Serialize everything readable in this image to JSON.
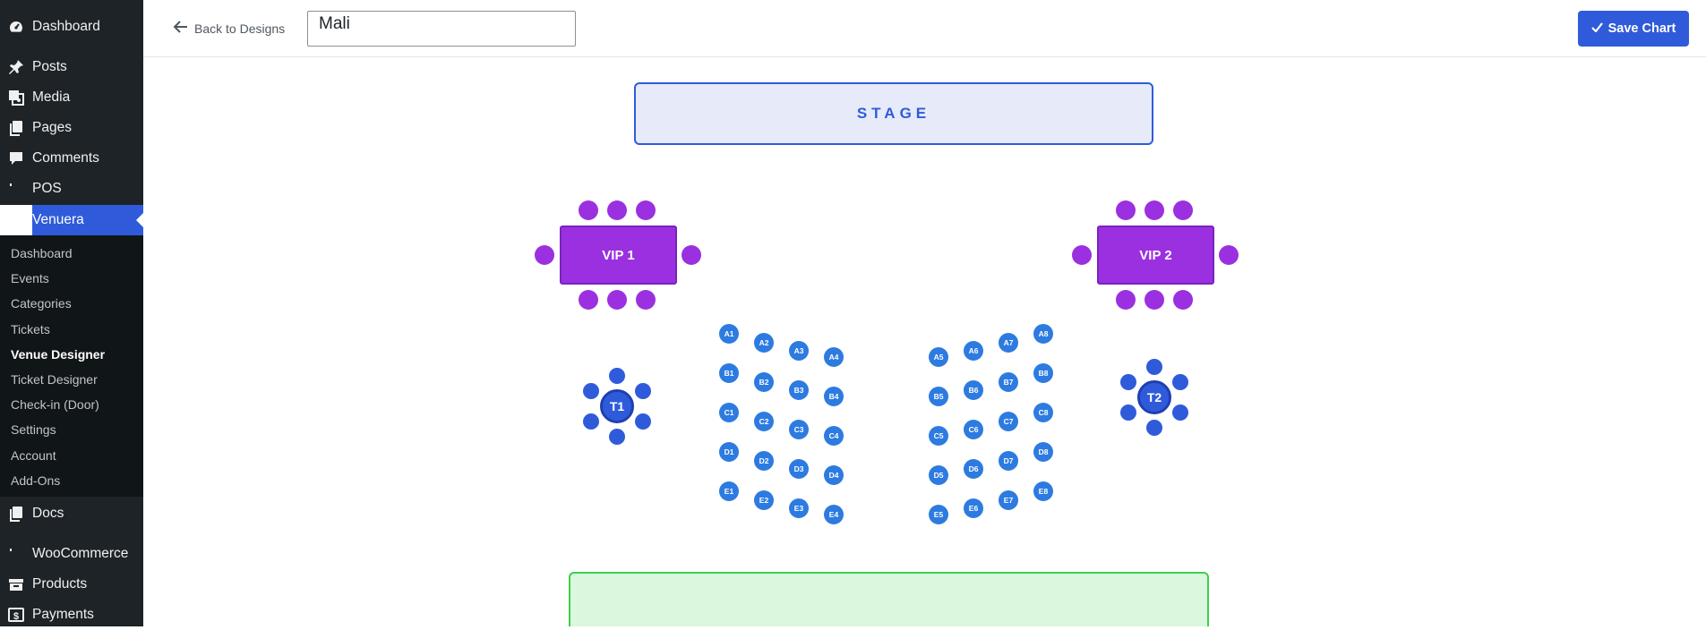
{
  "menu": {
    "dashboard": "Dashboard",
    "posts": "Posts",
    "media": "Media",
    "pages": "Pages",
    "comments": "Comments",
    "pos": "POS",
    "venuera": "Venuera",
    "docs": "Docs",
    "woocommerce": "WooCommerce",
    "products": "Products",
    "payments": "Payments"
  },
  "submenu": [
    "Dashboard",
    "Events",
    "Categories",
    "Tickets",
    "Venue Designer",
    "Ticket Designer",
    "Check-in (Door)",
    "Settings",
    "Account",
    "Add-Ons"
  ],
  "submenu_active": "Venue Designer",
  "toolbar": {
    "back_label": "Back to Designs",
    "design_name": "Mali",
    "save_label": "Save Chart"
  },
  "chart": {
    "stage_label": "STAGE",
    "vip_tables": [
      "VIP 1",
      "VIP 2"
    ],
    "round_tables": [
      "T1",
      "T2"
    ],
    "left_block": [
      [
        "A1",
        "A2",
        "A3",
        "A4"
      ],
      [
        "B1",
        "B2",
        "B3",
        "B4"
      ],
      [
        "C1",
        "C2",
        "C3",
        "C4"
      ],
      [
        "D1",
        "D2",
        "D3",
        "D4"
      ],
      [
        "E1",
        "E2",
        "E3",
        "E4"
      ]
    ],
    "right_block": [
      [
        "A5",
        "A6",
        "A7",
        "A8"
      ],
      [
        "B5",
        "B6",
        "B7",
        "B8"
      ],
      [
        "C5",
        "C6",
        "C7",
        "C8"
      ],
      [
        "D5",
        "D6",
        "D7",
        "D8"
      ],
      [
        "E5",
        "E6",
        "E7",
        "E8"
      ]
    ]
  },
  "colors": {
    "accent": "#2f5bdb",
    "vip": "#9b30e0",
    "seat": "#2d7be0",
    "floor": "#dbf7dd",
    "sidebar": "#1d2327"
  }
}
